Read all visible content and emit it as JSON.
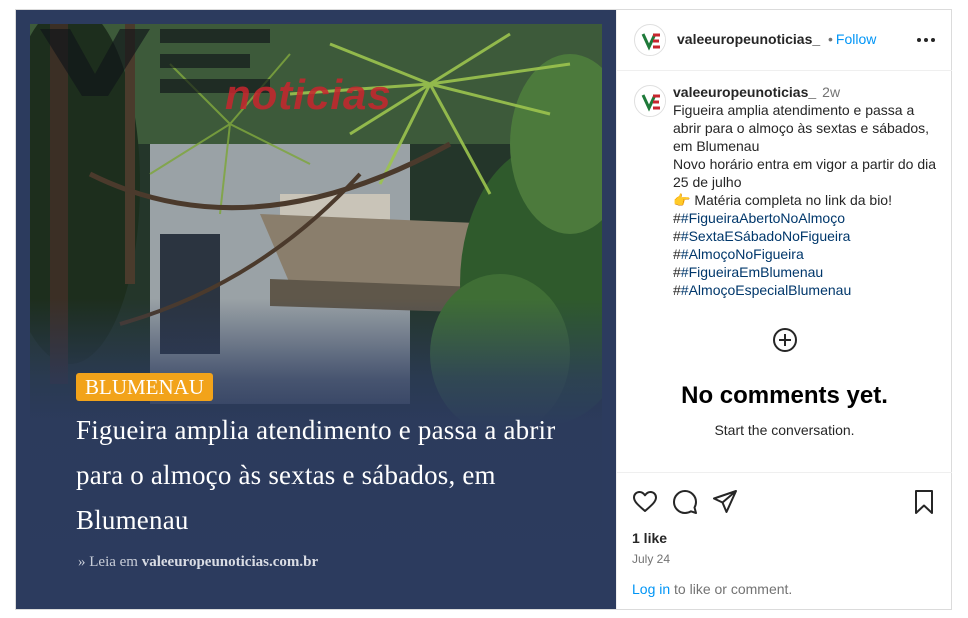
{
  "media": {
    "logo_text": "VE noticias",
    "category": "BLUMENAU",
    "headline": "Figueira amplia atendimento e passa a abrir para o almoço às sextas e sábados, em Blumenau",
    "read_more_prefix": "» Leia em",
    "read_more_site": "valeeuropeunoticias.com.br"
  },
  "header": {
    "username": "valeeuropeunoticias_",
    "follow_dot": "•",
    "follow_label": "Follow",
    "more_icon": "more-horizontal-icon"
  },
  "caption": {
    "username": "valeeuropeunoticias_",
    "age": "2w",
    "lines": [
      "Figueira amplia atendimento e passa a abrir para o almoço às sextas e sábados, em Blumenau",
      "Novo horário entra em vigor a partir do dia 25 de julho",
      "👉 Matéria completa no link da bio!"
    ],
    "hashtags": [
      {
        "prefix": "#",
        "tag": "#FigueiraAbertoNoAlmoço"
      },
      {
        "prefix": "#",
        "tag": "#SextaESábadoNoFigueira"
      },
      {
        "prefix": "#",
        "tag": "#AlmoçoNoFigueira"
      },
      {
        "prefix": "#",
        "tag": "#FigueiraEmBlumenau"
      },
      {
        "prefix": "#",
        "tag": "#AlmoçoEspecialBlumenau"
      }
    ]
  },
  "comments": {
    "empty_title": "No comments yet.",
    "empty_subtitle": "Start the conversation."
  },
  "actions": {
    "likes": "1 like",
    "date": "July 24",
    "login_link": "Log in",
    "login_suffix": " to like or comment."
  },
  "colors": {
    "media_bg": "#2c3b5e",
    "badge": "#f2a31a",
    "link_blue": "#0095f6",
    "hashtag": "#00376b"
  }
}
